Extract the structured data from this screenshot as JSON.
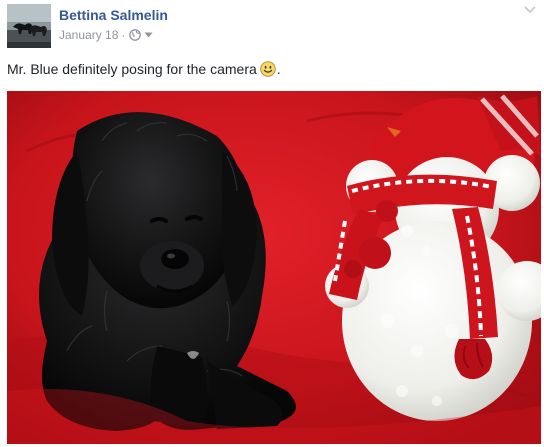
{
  "post": {
    "author": "Bettina Salmelin",
    "date": "January 18",
    "separator": "·",
    "text": "Mr. Blue definitely posing for the camera",
    "text_end": ".",
    "icons": {
      "avatar": "profile-photo-dogs-on-beach",
      "audience": "globe-icon",
      "audience_dropdown": "caret-down-icon",
      "post_menu": "chevron-down-icon",
      "emoji": "smile-emoji-icon"
    }
  },
  "colors": {
    "link": "#365899",
    "meta": "#90949c",
    "text": "#1d2129",
    "photo_background": "#c8141b"
  }
}
